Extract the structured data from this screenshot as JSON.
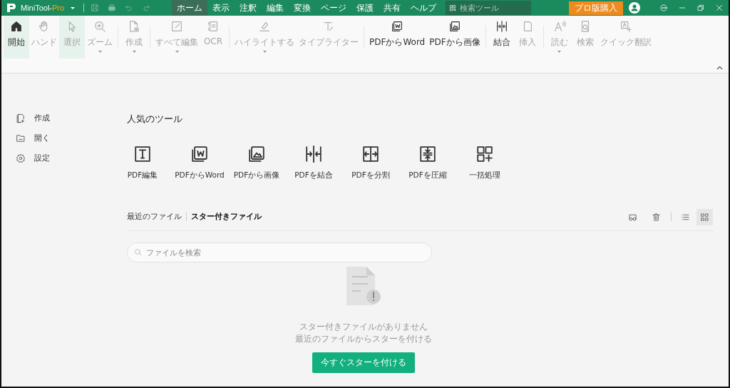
{
  "title_bar": {
    "app_name": "MiniTool-",
    "edition": "Pro",
    "menu": [
      {
        "label": "ホーム",
        "selected": true
      },
      {
        "label": "表示",
        "selected": false
      },
      {
        "label": "注釈",
        "selected": false
      },
      {
        "label": "編集",
        "selected": false
      },
      {
        "label": "変換",
        "selected": false
      },
      {
        "label": "ページ",
        "selected": false
      },
      {
        "label": "保護",
        "selected": false
      },
      {
        "label": "共有",
        "selected": false
      },
      {
        "label": "ヘルプ",
        "selected": false
      }
    ],
    "search": {
      "placeholder": "検索ツール"
    },
    "buy_button": "プロ版購入"
  },
  "toolbar": {
    "groups": [
      {
        "items": [
          {
            "label": "開始",
            "selected": true,
            "disabled": false,
            "dropdown": false
          },
          {
            "label": "ハンド",
            "selected": false,
            "disabled": true,
            "dropdown": false
          },
          {
            "label": "選択",
            "selected": true,
            "disabled": true,
            "dropdown": false
          },
          {
            "label": "ズーム",
            "selected": false,
            "disabled": true,
            "dropdown": true
          }
        ]
      },
      {
        "items": [
          {
            "label": "作成",
            "selected": false,
            "disabled": true,
            "dropdown": true
          }
        ]
      },
      {
        "items": [
          {
            "label": "すべて編集",
            "selected": false,
            "disabled": true,
            "dropdown": true
          },
          {
            "label": "OCR",
            "selected": false,
            "disabled": true,
            "dropdown": false
          }
        ]
      },
      {
        "items": [
          {
            "label": "ハイライトする",
            "selected": false,
            "disabled": true,
            "dropdown": true
          },
          {
            "label": "タイプライター",
            "selected": false,
            "disabled": true,
            "dropdown": false
          }
        ]
      },
      {
        "items": [
          {
            "label": "PDFからWord",
            "selected": false,
            "disabled": false,
            "dropdown": false
          },
          {
            "label": "PDFから画像",
            "selected": false,
            "disabled": false,
            "dropdown": false
          }
        ]
      },
      {
        "items": [
          {
            "label": "結合",
            "selected": false,
            "disabled": false,
            "dropdown": false
          },
          {
            "label": "挿入",
            "selected": false,
            "disabled": true,
            "dropdown": false
          }
        ]
      },
      {
        "items": [
          {
            "label": "読む",
            "selected": false,
            "disabled": true,
            "dropdown": true
          },
          {
            "label": "検索",
            "selected": false,
            "disabled": true,
            "dropdown": false
          },
          {
            "label": "クイック翻訳",
            "selected": false,
            "disabled": true,
            "dropdown": false
          }
        ]
      }
    ]
  },
  "sidebar": {
    "items": [
      "作成",
      "開く",
      "設定"
    ]
  },
  "popular_tools": {
    "title": "人気のツール",
    "tools": [
      "PDF編集",
      "PDFからWord",
      "PDFから画像",
      "PDFを結合",
      "PDFを分割",
      "PDFを圧縮",
      "一括処理"
    ]
  },
  "files": {
    "tabs": [
      {
        "label": "最近のファイル",
        "selected": false
      },
      {
        "label": "スター付きファイル",
        "selected": true
      }
    ],
    "views": [
      {
        "kind": "list",
        "selected": false
      },
      {
        "kind": "grid",
        "selected": true
      }
    ],
    "search": {
      "placeholder": "ファイルを検索"
    },
    "empty_state": {
      "message": "スター付きファイルがありません",
      "hint": "最近のファイルからスターを付ける",
      "button": "今すぐスターを付ける"
    }
  }
}
